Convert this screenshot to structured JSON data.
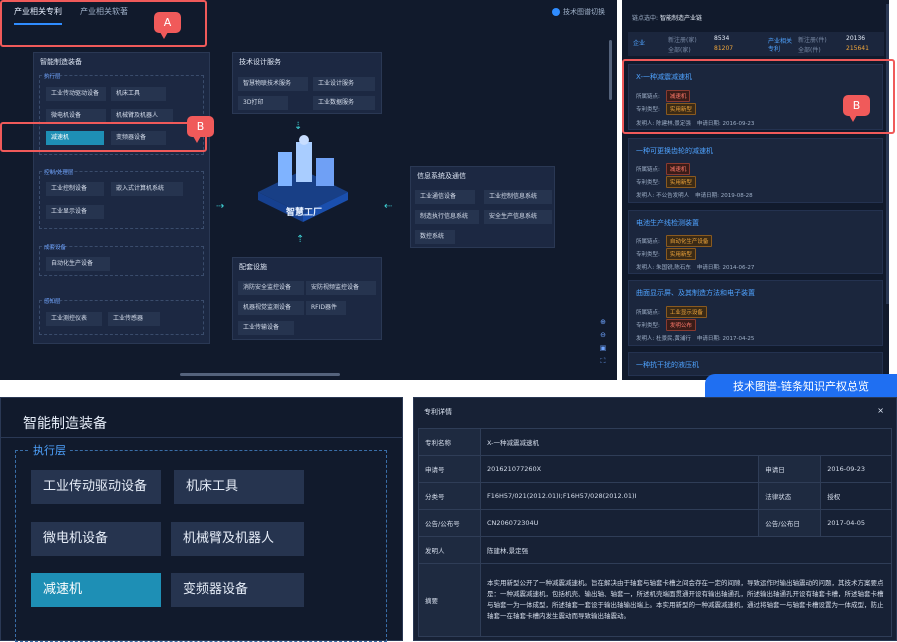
{
  "tabs": [
    "产业相关专利",
    "产业相关软著"
  ],
  "switch_label": "技术图谱切换",
  "cards": {
    "smart_mfg": {
      "title": "智能制造装备",
      "groups": [
        {
          "label": "执行层",
          "nodes": [
            "工业传动驱动设备",
            "机床工具",
            "微电机设备",
            "机械臂及机器人",
            "减速机",
            "变频器设备"
          ]
        },
        {
          "label": "控制/处理层",
          "nodes": [
            "工业控制设备",
            "嵌入式计算机系统",
            "工业显示设备"
          ]
        },
        {
          "label": "成套设备",
          "nodes": [
            "自动化生产设备"
          ]
        },
        {
          "label": "感知层",
          "nodes": [
            "工业测控仪表",
            "工业传感器"
          ]
        }
      ]
    },
    "tech": {
      "title": "技术设计服务",
      "nodes": [
        "智慧物联技术服务",
        "工业设计服务",
        "3D打印",
        "工业数据服务"
      ]
    },
    "info": {
      "title": "信息系统及通信",
      "nodes": [
        "工业通信设备",
        "工业控制信息系统",
        "制造执行信息系统",
        "安全生产信息系统",
        "数控系统"
      ]
    },
    "config": {
      "title": "配套设施",
      "nodes": [
        "消防安全监控设备",
        "安防视频监控设备",
        "机器视觉监测设备",
        "RFID器件",
        "工业传输设备"
      ]
    }
  },
  "center_label": "智慧工厂",
  "zoom_icons": [
    "zoom-in-icon",
    "zoom-out-icon",
    "fit-icon",
    "fullscreen-icon"
  ],
  "right": {
    "node_label": "链点选中:",
    "node_value": "智能制造产业链",
    "stats": {
      "left_title": "企业",
      "left_rows": [
        {
          "k": "新注册(家)",
          "v": "8534"
        },
        {
          "k": "全部(家)",
          "v": "81207"
        }
      ],
      "right_title": "产业相关专利",
      "right_rows": [
        {
          "k": "新注册(件)",
          "v": "20136"
        },
        {
          "k": "全部(件)",
          "v": "215641"
        }
      ]
    },
    "patents": [
      {
        "title": "X-一种减震减速机",
        "node": "减速机",
        "type": "实用新型",
        "inventor": "发明人: 陈建林,景定强",
        "date": "申请日期: 2016-09-23"
      },
      {
        "title": "一种可更换齿轮的减速机",
        "node": "减速机",
        "type": "实用新型",
        "inventor": "发明人: 不公告发明人",
        "date": "申请日期: 2019-08-28"
      },
      {
        "title": "电池生产线检测装置",
        "node": "自动化生产设备",
        "type": "实用新型",
        "inventor": "发明人: 朱国锐,陈石东",
        "date": "申请日期: 2014-06-27"
      },
      {
        "title": "曲面显示屏、及其制造方法和电子装置",
        "node": "工业显示设备",
        "type": "发明公布",
        "inventor": "发明人: 杜景民,黄浦行",
        "date": "申请日期: 2017-04-25"
      },
      {
        "title": "一种抗干扰的液压机",
        "node": "",
        "type": "",
        "inventor": "",
        "date": ""
      }
    ],
    "row_labels": {
      "node": "所属链点:",
      "type": "专利类型:"
    }
  },
  "callouts": {
    "a": "A",
    "b": "B"
  },
  "banner": "技术图谱-链条知识产权总览",
  "crop": {
    "title": "智能制造装备",
    "group": "执行层",
    "nodes": [
      "工业传动驱动设备",
      "机床工具",
      "微电机设备",
      "机械臂及机器人",
      "减速机",
      "变频器设备"
    ]
  },
  "detail": {
    "title": "专利详情",
    "close": "×",
    "name_k": "专利名称",
    "name_v": "X-一种减震减速机",
    "app_k": "申请号",
    "app_v": "201621077260X",
    "date_k": "申请日",
    "date_v": "2016-09-23",
    "cls_k": "分类号",
    "cls_v": "F16H57/021(2012.01)I;F16H57/028(2012.01)I",
    "law_k": "法律状态",
    "law_v": "授权",
    "pub_k": "公告/公布号",
    "pub_v": "CN206072304U",
    "pubd_k": "公告/公布日",
    "pubd_v": "2017-04-05",
    "inv_k": "发明人",
    "inv_v": "陈建林,景定强",
    "abs_k": "摘要",
    "abs_v": "本实用新型公开了一种减震减速机。旨在解决由于轴套与轴套卡槽之间会存在一定的间隙，导致运作时输出轴震动的问题，其技术方案要点是：一种减震减速机，包括机壳、输出轴、轴套一，所述机壳端面贯通开设有输出轴通孔，所述输出轴通孔开设有轴套卡槽，所述轴套卡槽与轴套一为一体成型，所述轴套一套设于输出轴输出端上。本实用新型的一种减震减速机，通过将轴套一与轴套卡槽设置为一体成型，防止轴套一在轴套卡槽内发生震动而导致输出轴震动。"
  }
}
